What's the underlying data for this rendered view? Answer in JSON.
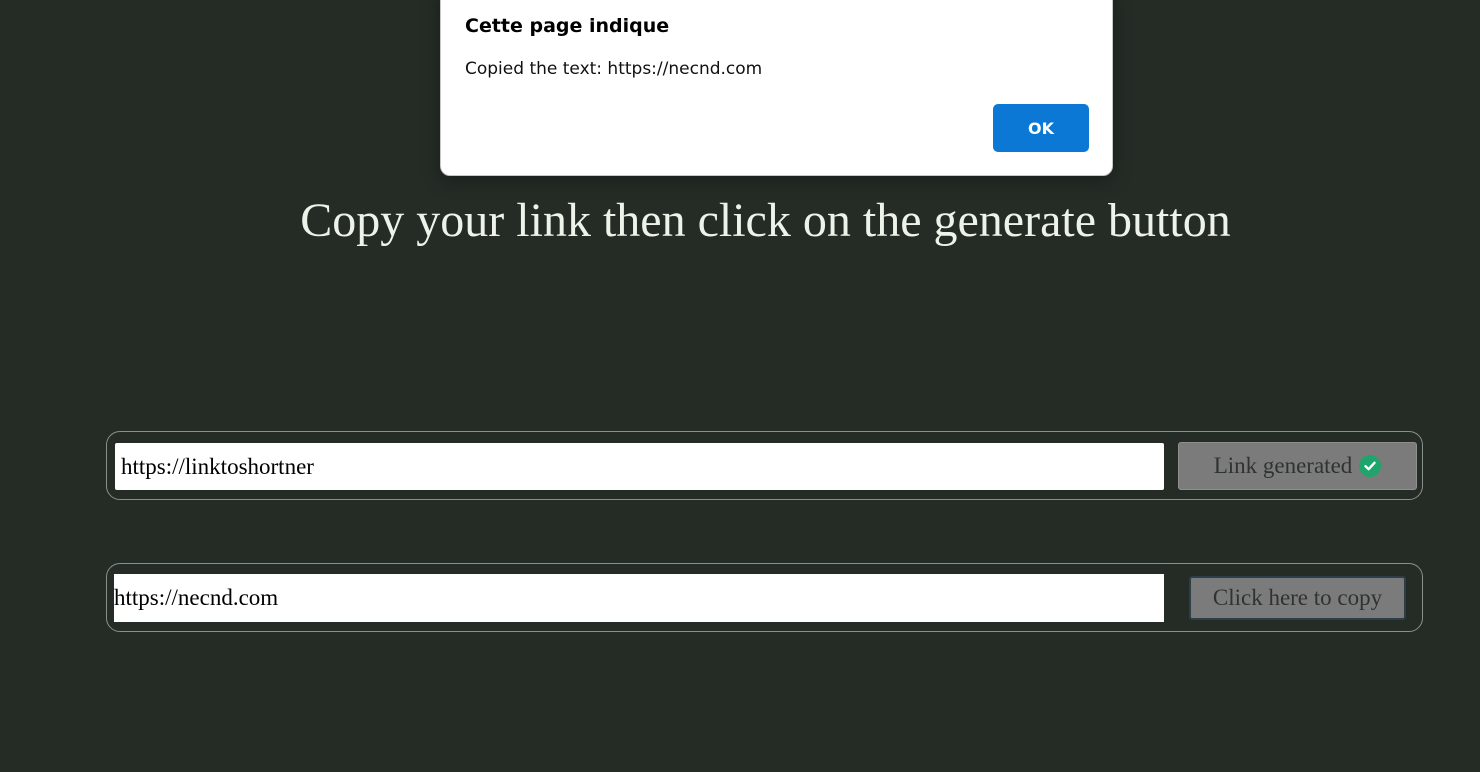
{
  "page": {
    "heading": "Copy your link then click on the generate button"
  },
  "shortener": {
    "input_value": "https://linktoshortner",
    "generate_button_label": "Link generated",
    "generate_button_icon": "check-circle-icon"
  },
  "result": {
    "output_value": "https://necnd.com",
    "copy_button_label": "Click here to copy"
  },
  "alert_dialog": {
    "title": "Cette page indique",
    "message": "Copied the text: https://necnd.com",
    "ok_label": "OK"
  },
  "colors": {
    "background": "#252c26",
    "button_gray": "#7b7b7b",
    "check_green": "#1fa46b",
    "dialog_ok_blue": "#0b78d6"
  }
}
